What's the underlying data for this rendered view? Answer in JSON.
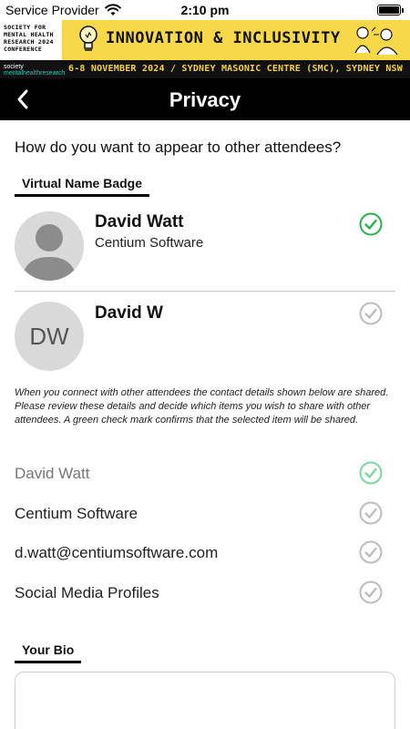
{
  "status_bar": {
    "carrier": "Service Provider",
    "time": "2:10 pm"
  },
  "banner": {
    "org_lines": [
      "SOCIETY FOR",
      "MENTAL HEALTH",
      "RESEARCH 2024",
      "CONFERENCE"
    ],
    "title": "INNOVATION & INCLUSIVITY",
    "logo_prefix": "society",
    "logo_text": "mentalhealthresearch",
    "dates_venue": "6-8 NOVEMBER 2024 / SYDNEY MASONIC CENTRE (SMC), SYDNEY NSW",
    "colors": {
      "yellow": "#f5d23a",
      "dark": "#111111",
      "teal": "#2ec4b6"
    }
  },
  "nav": {
    "title": "Privacy",
    "back_icon": "chevron-left-icon"
  },
  "page": {
    "question": "How do you want to appear to other attendees?",
    "badge_section_label": "Virtual Name Badge",
    "badge_options": [
      {
        "name": "David Watt",
        "organization": "Centium Software",
        "avatar": "person-silhouette",
        "selected": true
      },
      {
        "name": "David W",
        "initials": "DW",
        "selected": false
      }
    ],
    "info_text": "When you connect with other attendees the contact details shown below are shared. Please review these details and decide which items you wish to share with other attendees. A green check mark confirms that the selected item will be shared.",
    "share_items": [
      {
        "label": "David Watt",
        "checked": true,
        "muted": true
      },
      {
        "label": "Centium Software",
        "checked": false
      },
      {
        "label": "d.watt@centiumsoftware.com",
        "checked": false
      },
      {
        "label": "Social Media Profiles",
        "checked": false
      }
    ],
    "bio_section_label": "Your Bio"
  },
  "colors": {
    "check_active": "#2ab24f",
    "check_active_light": "#7fd6a0",
    "check_inactive": "#bdbdbd"
  }
}
